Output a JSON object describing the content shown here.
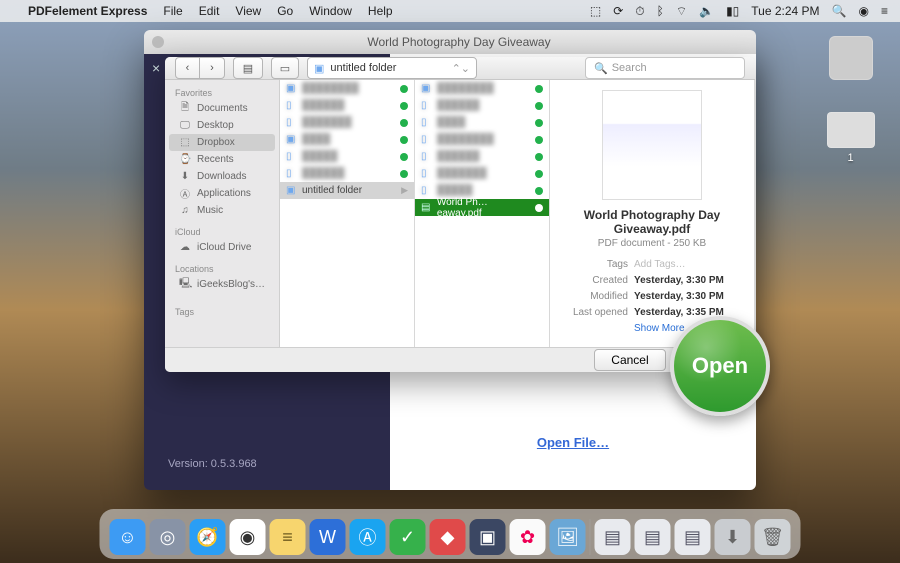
{
  "menubar": {
    "app": "PDFelement Express",
    "items": [
      "File",
      "Edit",
      "View",
      "Go",
      "Window",
      "Help"
    ],
    "clock": "Tue 2:24 PM",
    "battery_icon": "battery-icon",
    "wifi_icon": "wifi-icon",
    "bt_icon": "bluetooth-icon",
    "dropbox_icon": "dropbox-icon"
  },
  "desktop": {
    "thumb_label": "1"
  },
  "appwin": {
    "title": "World Photography Day Giveaway",
    "version_label": "Version: 0.5.3.968",
    "open_file_link": "Open File…"
  },
  "sheet": {
    "path_label": "untitled folder",
    "search_placeholder": "Search",
    "sidebar": {
      "favorites_hdr": "Favorites",
      "favorites": [
        "Documents",
        "Desktop",
        "Dropbox",
        "Recents",
        "Downloads",
        "Applications",
        "Music"
      ],
      "icloud_hdr": "iCloud",
      "icloud": [
        "iCloud Drive"
      ],
      "locations_hdr": "Locations",
      "locations": [
        "iGeeksBlog's…"
      ],
      "tags_hdr": "Tags",
      "selected": "Dropbox"
    },
    "col1_selected": "untitled folder",
    "col2_selected": "World Ph…eaway.pdf",
    "preview": {
      "title": "World Photography Day Giveaway.pdf",
      "subtitle": "PDF document - 250 KB",
      "tags_label": "Tags",
      "tags_value": "Add Tags…",
      "created_label": "Created",
      "created_value": "Yesterday, 3:30 PM",
      "modified_label": "Modified",
      "modified_value": "Yesterday, 3:30 PM",
      "lastopened_label": "Last opened",
      "lastopened_value": "Yesterday, 3:35 PM",
      "showmore": "Show More"
    },
    "cancel": "Cancel",
    "open": "Open"
  },
  "dock": {
    "items": [
      "finder",
      "launchpad",
      "safari",
      "chrome",
      "notes",
      "word",
      "appstore",
      "check",
      "slack",
      "pdfelement",
      "photos",
      "preview"
    ],
    "right": [
      "pages",
      "pages2",
      "pages3",
      "downloads",
      "trash"
    ]
  },
  "magnify": {
    "label": "Open"
  }
}
